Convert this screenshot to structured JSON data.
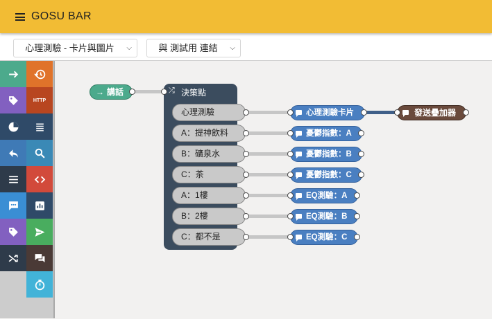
{
  "app": {
    "title": "GOSU BAR"
  },
  "selectors": {
    "card": {
      "value": "心理測驗 - 卡片與圖片"
    },
    "link": {
      "value": "與 測試用 連結"
    }
  },
  "toolbox": {
    "items": [
      {
        "icon": "arrow-right-icon",
        "color": "#4caa8c"
      },
      {
        "icon": "history-icon",
        "color": "#e0732a"
      },
      {
        "icon": "tag-icon",
        "color": "#8260c0"
      },
      {
        "icon": "http-icon",
        "label": "HTTP",
        "color": "#b84620"
      },
      {
        "icon": "pie-chart-icon",
        "color": "#2f4a68"
      },
      {
        "icon": "list-icon",
        "color": "#2f4a68"
      },
      {
        "icon": "reply-icon",
        "color": "#3f7ab6"
      },
      {
        "icon": "search-icon",
        "color": "#3a89b6"
      },
      {
        "icon": "menu-lines-icon",
        "color": "#2e3b4a"
      },
      {
        "icon": "code-icon",
        "color": "#d24a3b"
      },
      {
        "icon": "chat-dots-icon",
        "color": "#3a8ed4"
      },
      {
        "icon": "bar-chart-icon",
        "color": "#2f4a68"
      },
      {
        "icon": "tag-icon",
        "color": "#8260c0"
      },
      {
        "icon": "send-icon",
        "color": "#49ad5f"
      },
      {
        "icon": "shuffle-icon",
        "color": "#2e3b4a"
      },
      {
        "icon": "forum-icon",
        "color": "#4a3a36"
      },
      {
        "icon": "timer-icon",
        "color": "#42b3d8"
      }
    ]
  },
  "flow": {
    "speak_node": {
      "label": "講話"
    },
    "decision_node": {
      "title": "決策點"
    },
    "options": [
      {
        "label": "心理測驗"
      },
      {
        "label": "A：提神飲料"
      },
      {
        "label": "B：礦泉水"
      },
      {
        "label": "C：茶"
      },
      {
        "label": "A：1樓"
      },
      {
        "label": "B：2樓"
      },
      {
        "label": "C：都不是"
      }
    ],
    "targets": [
      {
        "label": "心理測驗卡片"
      },
      {
        "label": "憂鬱指數：A"
      },
      {
        "label": "憂鬱指數：B"
      },
      {
        "label": "憂鬱指數：C"
      },
      {
        "label": "EQ測驗：A"
      },
      {
        "label": "EQ測驗：B"
      },
      {
        "label": "EQ測驗：C"
      }
    ],
    "sender_node": {
      "label": "發送疊加器"
    }
  }
}
